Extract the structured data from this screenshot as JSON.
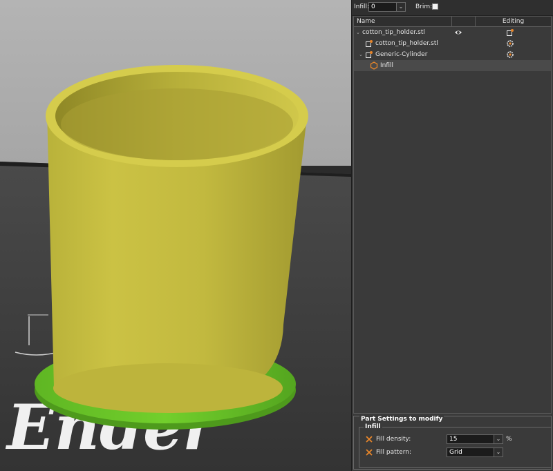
{
  "toolbar": {
    "infill_label": "Infill:",
    "infill_value": "0",
    "brim_label": "Brim:",
    "brim_checked": false
  },
  "object_list": {
    "columns": {
      "name": "Name",
      "editing": "Editing"
    },
    "rows": [
      {
        "label": "cotton_tip_holder.stl",
        "level": 0,
        "expanded": true,
        "visible_icon": "eye-icon",
        "edit_icon": "edit-object-icon"
      },
      {
        "label": "cotton_tip_holder.stl",
        "level": 1,
        "type_icon": "part-icon",
        "edit_icon": "gear-icon"
      },
      {
        "label": "Generic-Cylinder",
        "level": 1,
        "expanded": true,
        "type_icon": "modifier-icon",
        "edit_icon": "gear-icon"
      },
      {
        "label": "Infill",
        "level": 2,
        "type_icon": "infill-icon",
        "selected": true
      }
    ]
  },
  "part_settings": {
    "title": "Part Settings to modify",
    "group": "Infill",
    "rows": [
      {
        "label": "Fill density:",
        "value": "15",
        "unit": "%"
      },
      {
        "label": "Fill pattern:",
        "value": "Grid",
        "unit": ""
      }
    ]
  },
  "viewport": {
    "bed_logo_text": "Ender",
    "object_color": "#c8be3c",
    "brim_color": "#6ecc2a"
  }
}
